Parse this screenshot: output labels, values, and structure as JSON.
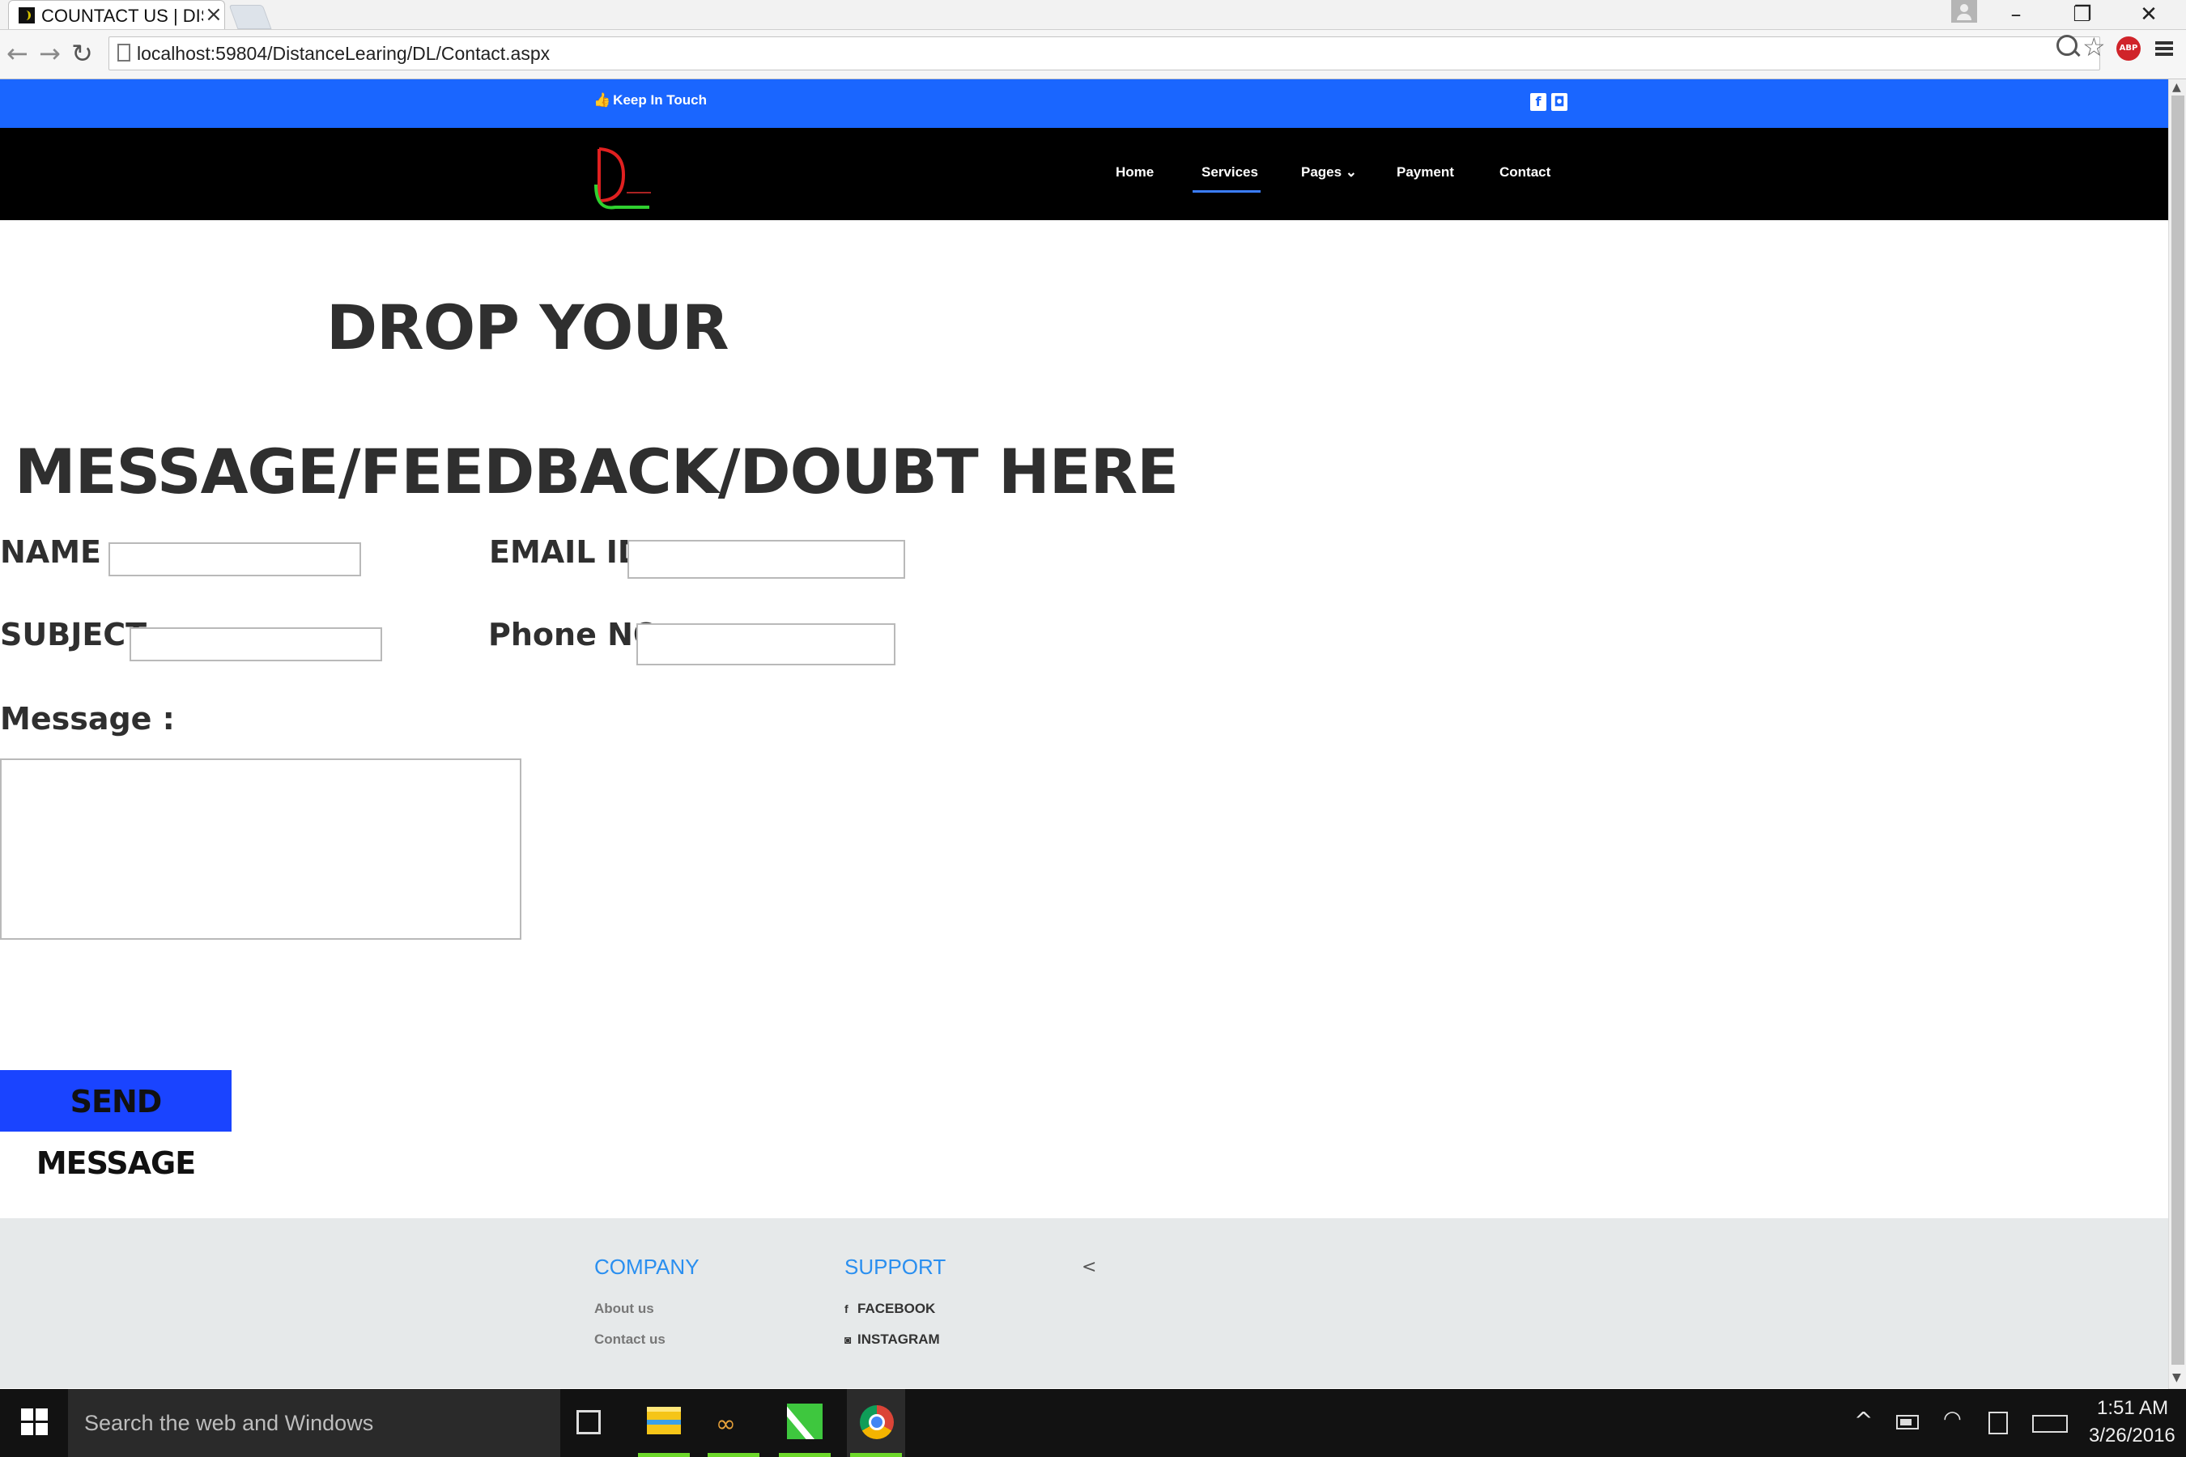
{
  "browser": {
    "tab_title": "COUNTACT US | DIS",
    "tab_close": "×",
    "window_controls": {
      "minimize": "–",
      "restore": "❐",
      "close": "✕"
    },
    "nav": {
      "back": "←",
      "forward": "→",
      "reload": "↻"
    },
    "url": "localhost:59804/DistanceLearing/DL/Contact.aspx",
    "star": "☆",
    "abp_label": "ABP"
  },
  "topbar": {
    "thumb": "👍",
    "keep_in_touch": "Keep In Touch",
    "facebook_glyph": "f",
    "instagram_glyph": "◘"
  },
  "navbar": {
    "items": [
      {
        "label": "Home"
      },
      {
        "label": "Services"
      },
      {
        "label": "Pages ⌄"
      },
      {
        "label": "Payment"
      },
      {
        "label": "Contact"
      }
    ],
    "active": "Services"
  },
  "main": {
    "heading_line1": "DROP YOUR",
    "heading_line2": "MESSAGE/FEEDBACK/DOUBT HERE",
    "form": {
      "name_label": "NAME :",
      "name_value": "",
      "email_label": "EMAIL ID :",
      "email_value": "",
      "subject_label": "SUBJECT :",
      "subject_value": "",
      "phone_label": "Phone NO:",
      "phone_value": "",
      "message_label": "Message :",
      "message_value": "",
      "submit_label": "SEND MESSAGE"
    }
  },
  "footer": {
    "company_heading": "COMPANY",
    "support_heading": "SUPPORT",
    "arrow": "<",
    "company_links": [
      "About us",
      "Contact us"
    ],
    "support_links": [
      "FACEBOOK",
      "INSTAGRAM"
    ],
    "support_icons": [
      "f",
      "◙"
    ]
  },
  "scrollbar": {
    "up": "▲",
    "down": "▼"
  },
  "taskbar": {
    "search_placeholder": "Search the web and Windows",
    "multi_glyph": "∞",
    "tray_chevron": "^",
    "tray_wifi": "◠",
    "time": "1:51 AM",
    "date": "3/26/2016"
  },
  "colors": {
    "topbar": "#1a66ff",
    "navbar": "#000000",
    "submit_button": "#1a44ff",
    "footer": "#e6e9ea",
    "footer_heading": "#2a8ff0"
  }
}
